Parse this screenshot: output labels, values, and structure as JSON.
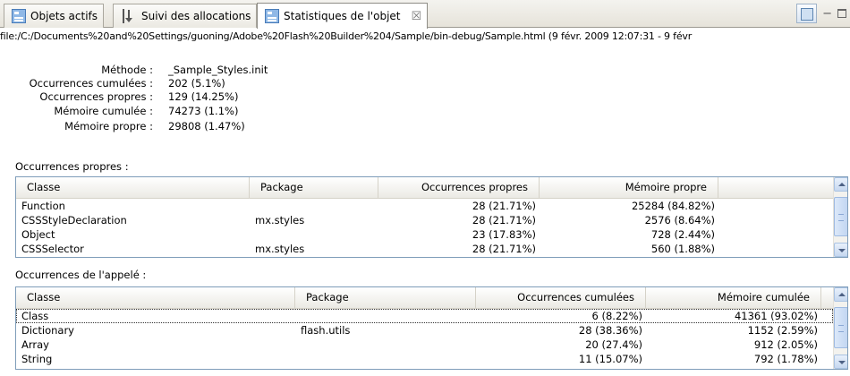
{
  "tabs": [
    {
      "label": "Objets actifs",
      "icon": "objects-icon"
    },
    {
      "label": "Suivi des allocations",
      "icon": "allocation-trace-icon"
    },
    {
      "label": "Statistiques de l'objet",
      "icon": "object-statistics-icon",
      "close": "☒"
    }
  ],
  "view_toolbar": {
    "minimize": "−"
  },
  "path": "file:/C:/Documents%20and%20Settings/guoning/Adobe%20Flash%20Builder%204/Sample/bin-debug/Sample.html (9 févr. 2009 12:07:31 - 9 févr",
  "details": [
    {
      "label": "Méthode :",
      "value": "_Sample_Styles.init"
    },
    {
      "label": "Occurrences cumulées :",
      "value": "202 (5.1%)"
    },
    {
      "label": "Occurrences propres :",
      "value": "129 (14.25%)"
    },
    {
      "label": "Mémoire cumulée :",
      "value": "74273 (1.1%)"
    },
    {
      "label": "Mémoire propre :",
      "value": "29808 (1.47%)"
    }
  ],
  "self_table": {
    "section_label": "Occurrences propres :",
    "columns": [
      "Classe",
      "Package",
      "Occurrences propres",
      "Mémoire propre"
    ],
    "rows": [
      [
        "Function",
        "",
        "28 (21.71%)",
        "25284 (84.82%)"
      ],
      [
        "CSSStyleDeclaration",
        "mx.styles",
        "28 (21.71%)",
        "2576 (8.64%)"
      ],
      [
        "Object",
        "",
        "23 (17.83%)",
        "728 (2.44%)"
      ],
      [
        "CSSSelector",
        "mx.styles",
        "28 (21.71%)",
        "560 (1.88%)"
      ]
    ]
  },
  "callee_table": {
    "section_label": "Occurrences de l'appelé :",
    "columns": [
      "Classe",
      "Package",
      "Occurrences cumulées",
      "Mémoire cumulée"
    ],
    "rows": [
      [
        "Class",
        "",
        "6 (8.22%)",
        "41361 (93.02%)"
      ],
      [
        "Dictionary",
        "flash.utils",
        "28 (38.36%)",
        "1152 (2.59%)"
      ],
      [
        "Array",
        "",
        "20 (27.4%)",
        "912 (2.05%)"
      ],
      [
        "String",
        "",
        "11 (15.07%)",
        "792 (1.78%)"
      ]
    ]
  }
}
